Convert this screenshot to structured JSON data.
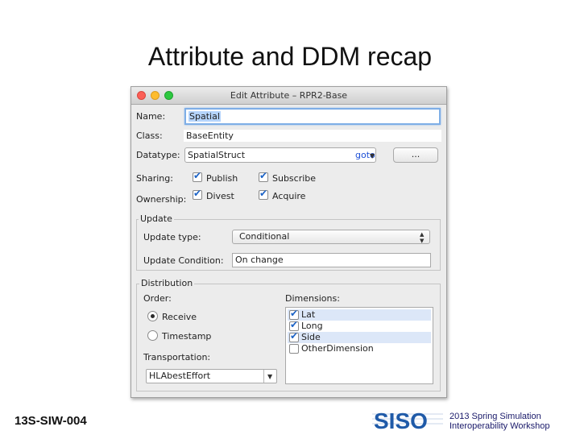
{
  "slide": {
    "title": "Attribute and DDM recap",
    "footer_left": "13S-SIW-004",
    "footer_right_line1": "2013 Spring Simulation",
    "footer_right_line2": "Interoperability Workshop",
    "logo_text": "SISO"
  },
  "window": {
    "title": "Edit Attribute – RPR2-Base",
    "name_label": "Name:",
    "name_value": "Spatial",
    "class_label": "Class:",
    "class_value": "BaseEntity",
    "datatype_label": "Datatype:",
    "datatype_value": "SpatialStruct",
    "datatype_link": "goto",
    "browse_label": "...",
    "sharing_label": "Sharing:",
    "publish_label": "Publish",
    "subscribe_label": "Subscribe",
    "ownership_label": "Ownership:",
    "divest_label": "Divest",
    "acquire_label": "Acquire",
    "update_group": "Update",
    "update_type_label": "Update type:",
    "update_type_value": "Conditional",
    "update_condition_label": "Update Condition:",
    "update_condition_value": "On change",
    "distribution_group": "Distribution",
    "order_label": "Order:",
    "receive_label": "Receive",
    "timestamp_label": "Timestamp",
    "dimensions_label": "Dimensions:",
    "dimensions": [
      {
        "label": "Lat",
        "checked": true
      },
      {
        "label": "Long",
        "checked": true
      },
      {
        "label": "Side",
        "checked": true
      },
      {
        "label": "OtherDimension",
        "checked": false
      }
    ],
    "transportation_label": "Transportation:",
    "transportation_value": "HLAbestEffort"
  },
  "state": {
    "publish": true,
    "subscribe": true,
    "divest": true,
    "acquire": true,
    "order": "Receive"
  },
  "colors": {
    "link": "#1c4fd6",
    "focus": "#7eaee6",
    "check": "#1c63c6",
    "logo_blue": "#1f5aa8"
  }
}
